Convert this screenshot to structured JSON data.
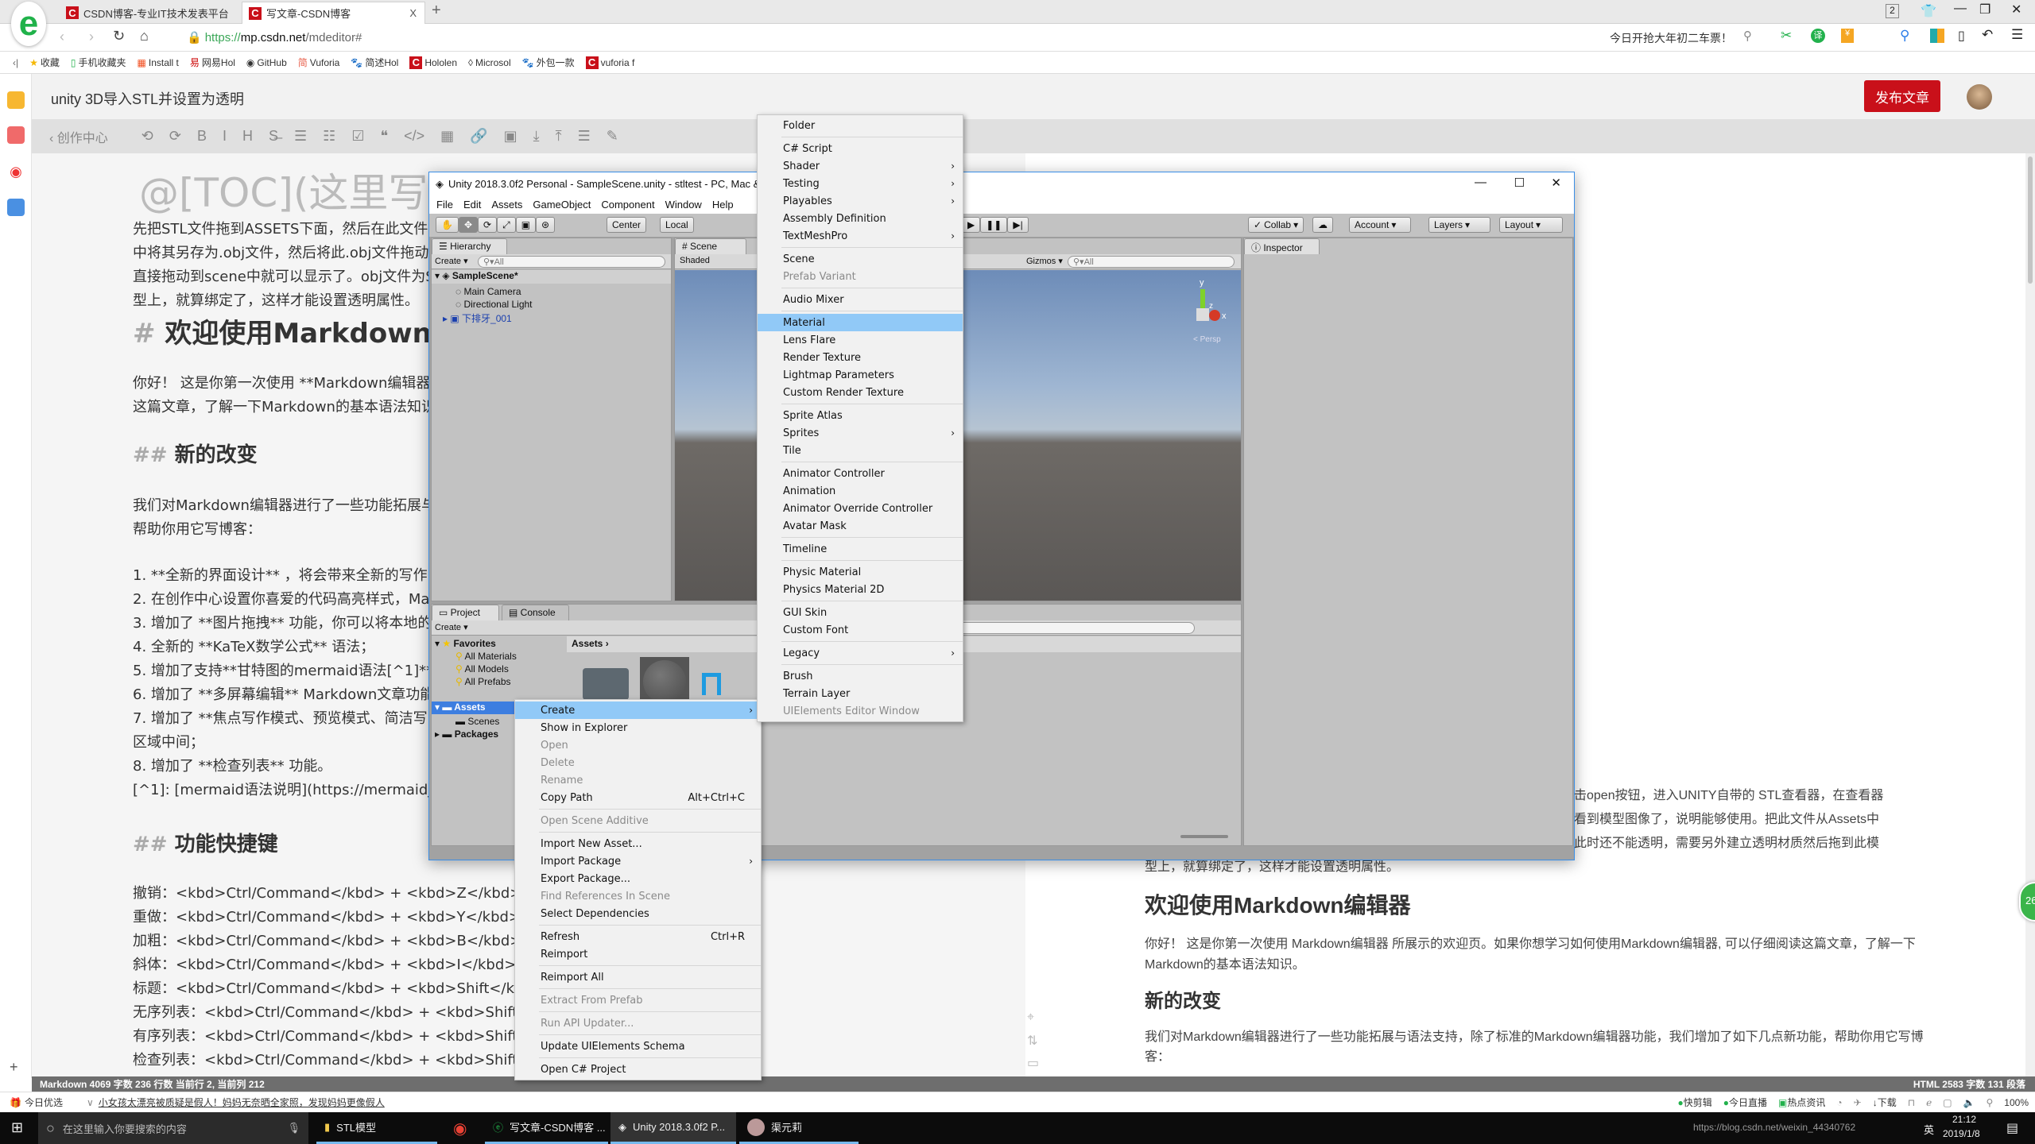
{
  "browser": {
    "tabs": [
      {
        "label": "CSDN博客-专业IT技术发表平台"
      },
      {
        "label": "写文章-CSDN博客",
        "close": "X"
      }
    ],
    "new_tab": "+",
    "url_scheme": "https://",
    "url_host": "mp.csdn.net",
    "url_path": "/mdeditor#",
    "promo": "今日开抢大年初二车票！",
    "window_count": "2",
    "bookmarks": [
      "收藏",
      "手机收藏夹",
      "Install t",
      "网易Hol",
      "GitHub",
      "Vuforia",
      "简述Hol",
      "Hololen",
      "Microsol",
      "外包一款",
      "vuforia f"
    ]
  },
  "editor": {
    "title": "unity 3D导入STL并设置为透明",
    "publish": "发布文章",
    "back": "创作中心",
    "toolbar_icons": [
      "undo-icon",
      "redo-icon",
      "bold-icon",
      "italic-icon",
      "heading-icon",
      "strikethrough-icon",
      "unordered-list-icon",
      "ordered-list-icon",
      "checklist-icon",
      "quote-icon",
      "code-icon",
      "table-icon",
      "link-icon",
      "image-icon",
      "download-icon",
      "upload-icon",
      "toc-icon",
      "sign-icon"
    ],
    "toolbar_glyphs": [
      "⟲",
      "⟳",
      "B",
      "I",
      "H",
      "S̶",
      "☰",
      "☷",
      "☑",
      "❝",
      "</>",
      "▦",
      "🔗",
      "▣",
      "⤓",
      "⤒",
      "☰",
      "✎"
    ],
    "left_lines": [
      {
        "text": "@[TOC](这里写自",
        "kind": "toc"
      },
      {
        "text": "先把STL文件拖到ASSETS下面，然后在此文件"
      },
      {
        "text": "中将其另存为.obj文件，然后将此.obj文件拖动到"
      },
      {
        "text": "直接拖动到scene中就可以显示了。obj文件为S"
      },
      {
        "text": "型上，就算绑定了，这样才能设置透明属性。"
      },
      {
        "hash": "#",
        "text": "欢迎使用Markdown编",
        "kind": "h1"
      },
      {
        "text": "你好！ 这是你第一次使用 **Markdown编辑器"
      },
      {
        "text": "这篇文章，了解一下Markdown的基本语法知识"
      },
      {
        "hash": "##",
        "text": "新的改变",
        "kind": "h2"
      },
      {
        "text": "我们对Markdown编辑器进行了一些功能拓展与"
      },
      {
        "text": "帮助你用它写博客："
      },
      {
        "text": "1. **全新的界面设计** ，将会带来全新的写作"
      },
      {
        "text": "2. 在创作中心设置你喜爱的代码高亮样式，Ma"
      },
      {
        "text": "3. 增加了 **图片拖拽** 功能，你可以将本地的"
      },
      {
        "text": "4. 全新的 **KaTeX数学公式** 语法；"
      },
      {
        "text": "5. 增加了支持**甘特图的mermaid语法[^1]** 功能"
      },
      {
        "text": "6. 增加了 **多屏幕编辑** Markdown文章功能"
      },
      {
        "text": "7. 增加了 **焦点写作模式、预览模式、简洁写"
      },
      {
        "text": "区域中间；"
      },
      {
        "text": "8. 增加了 **检查列表** 功能。"
      },
      {
        "text": "[^1]: [mermaid语法说明](https://mermaidjs.githu"
      },
      {
        "hash": "##",
        "text": "功能快捷键",
        "kind": "h2"
      },
      {
        "text": "撤销：<kbd>Ctrl/Command</kbd> + <kbd>Z</kbd>"
      },
      {
        "text": "重做：<kbd>Ctrl/Command</kbd> + <kbd>Y</kbd>"
      },
      {
        "text": "加粗：<kbd>Ctrl/Command</kbd> + <kbd>B</kbd>"
      },
      {
        "text": "斜体：<kbd>Ctrl/Command</kbd> + <kbd>I</kbd>"
      },
      {
        "text": "标题：<kbd>Ctrl/Command</kbd> + <kbd>Shift</kbd> + <kbd>H"
      },
      {
        "text": "无序列表：<kbd>Ctrl/Command</kbd> + <kbd>Shift</kbd> + <k"
      },
      {
        "text": "有序列表：<kbd>Ctrl/Command</kbd> + <kbd>Shift</kbd> + <k"
      },
      {
        "text": "检查列表：<kbd>Ctrl/Command</kbd> + <kbd>Shift</kbd> + <k"
      }
    ],
    "preview_lines": [
      {
        "text": "击open按钮，进入UNITY自带的 STL查看器，在查看器"
      },
      {
        "text": "看到模型图像了，说明能够使用。把此文件从Assets中"
      },
      {
        "text": "此时还不能透明，需要另外建立透明材质然后拖到此模"
      },
      {
        "text": "型上，就算绑定了，这样才能设置透明属性。"
      },
      {
        "text": "欢迎使用Markdown编辑器",
        "kind": "h1"
      },
      {
        "text": "你好！ 这是你第一次使用 Markdown编辑器 所展示的欢迎页。如果你想学习如何使用Markdown编辑器, 可以仔细阅读这篇文章，了解一下"
      },
      {
        "text": "Markdown的基本语法知识。"
      },
      {
        "text": "新的改变",
        "kind": "h2"
      },
      {
        "text": "我们对Markdown编辑器进行了一些功能拓展与语法支持，除了标准的Markdown编辑器功能，我们增加了如下几点新功能，帮助你用它写博"
      },
      {
        "text": "客："
      }
    ],
    "float_badge": "26",
    "status_left": "Markdown  4069 字数  236 行数  当前行 2, 当前列 212",
    "status_right": "HTML  2583 字数  131 段落"
  },
  "browser_status": {
    "left_label": "今日优选",
    "news": "小女孩太漂亮被质疑是假人！妈妈无奈晒全家照，发现妈妈更像假人",
    "right_items": [
      "快剪辑",
      "今日直播",
      "热点资讯",
      "下载"
    ],
    "zoom": "100%"
  },
  "unity": {
    "title": "Unity 2018.3.0f2 Personal - SampleScene.unity - stltest - PC, Mac &",
    "menu": [
      "File",
      "Edit",
      "Assets",
      "GameObject",
      "Component",
      "Window",
      "Help"
    ],
    "center": "Center",
    "local": "Local",
    "collab": "Collab",
    "account": "Account",
    "layers": "Layers",
    "layout": "Layout",
    "hierarchy": {
      "tab": "Hierarchy",
      "create": "Create",
      "search": "All",
      "scene": "SampleScene*",
      "items": [
        "Main Camera",
        "Directional Light",
        "下排牙_001"
      ]
    },
    "scene": {
      "tab": "Scene",
      "shaded": "Shaded",
      "gizmos": "Gizmos",
      "search": "All",
      "axis_y": "y",
      "axis_x": "x",
      "axis_z": "z",
      "persp": "< Persp"
    },
    "inspector": {
      "tab": "Inspector"
    },
    "project": {
      "tab": "Project",
      "console": "Console",
      "create": "Create",
      "favorites": "Favorites",
      "fav_items": [
        "All Materials",
        "All Models",
        "All Prefabs"
      ],
      "assets": "Assets",
      "sub": [
        "Scenes"
      ],
      "packages": "Packages",
      "breadcrumb": "Assets"
    },
    "context_menu": [
      {
        "label": "Create",
        "arrow": true,
        "highlight": true
      },
      {
        "label": "Show in Explorer"
      },
      {
        "label": "Open",
        "disabled": true
      },
      {
        "label": "Delete",
        "disabled": true
      },
      {
        "label": "Rename",
        "disabled": true
      },
      {
        "label": "Copy Path",
        "shortcut": "Alt+Ctrl+C"
      },
      {
        "sep": true
      },
      {
        "label": "Open Scene Additive",
        "disabled": true
      },
      {
        "sep": true
      },
      {
        "label": "Import New Asset..."
      },
      {
        "label": "Import Package",
        "arrow": true
      },
      {
        "label": "Export Package..."
      },
      {
        "label": "Find References In Scene",
        "disabled": true
      },
      {
        "label": "Select Dependencies"
      },
      {
        "sep": true
      },
      {
        "label": "Refresh",
        "shortcut": "Ctrl+R"
      },
      {
        "label": "Reimport"
      },
      {
        "sep": true
      },
      {
        "label": "Reimport All"
      },
      {
        "sep": true
      },
      {
        "label": "Extract From Prefab",
        "disabled": true
      },
      {
        "sep": true
      },
      {
        "label": "Run API Updater...",
        "disabled": true
      },
      {
        "sep": true
      },
      {
        "label": "Update UIElements Schema"
      },
      {
        "sep": true
      },
      {
        "label": "Open C# Project"
      }
    ],
    "create_submenu": [
      {
        "label": "Folder"
      },
      {
        "sep": true
      },
      {
        "label": "C# Script"
      },
      {
        "label": "Shader",
        "arrow": true
      },
      {
        "label": "Testing",
        "arrow": true
      },
      {
        "label": "Playables",
        "arrow": true
      },
      {
        "label": "Assembly Definition"
      },
      {
        "label": "TextMeshPro",
        "arrow": true
      },
      {
        "sep": true
      },
      {
        "label": "Scene"
      },
      {
        "label": "Prefab Variant",
        "disabled": true
      },
      {
        "sep": true
      },
      {
        "label": "Audio Mixer"
      },
      {
        "sep": true
      },
      {
        "label": "Material",
        "highlight": true
      },
      {
        "label": "Lens Flare"
      },
      {
        "label": "Render Texture"
      },
      {
        "label": "Lightmap Parameters"
      },
      {
        "label": "Custom Render Texture"
      },
      {
        "sep": true
      },
      {
        "label": "Sprite Atlas"
      },
      {
        "label": "Sprites",
        "arrow": true
      },
      {
        "label": "Tile"
      },
      {
        "sep": true
      },
      {
        "label": "Animator Controller"
      },
      {
        "label": "Animation"
      },
      {
        "label": "Animator Override Controller"
      },
      {
        "label": "Avatar Mask"
      },
      {
        "sep": true
      },
      {
        "label": "Timeline"
      },
      {
        "sep": true
      },
      {
        "label": "Physic Material"
      },
      {
        "label": "Physics Material 2D"
      },
      {
        "sep": true
      },
      {
        "label": "GUI Skin"
      },
      {
        "label": "Custom Font"
      },
      {
        "sep": true
      },
      {
        "label": "Legacy",
        "arrow": true
      },
      {
        "sep": true
      },
      {
        "label": "Brush"
      },
      {
        "label": "Terrain Layer"
      },
      {
        "label": "UIElements Editor Window",
        "disabled": true
      }
    ]
  },
  "taskbar": {
    "search": "在这里输入你要搜索的内容",
    "apps": [
      "STL模型",
      "写文章-CSDN博客 ...",
      "Unity 2018.3.0f2 P...",
      "渠元莉"
    ],
    "time": "21:12",
    "date": "2019/1/8",
    "ime": "英",
    "watermark": "https://blog.csdn.net/weixin_44340762"
  },
  "colors": {
    "brand_red": "#c9101a",
    "highlight": "#91c9f7",
    "selection_blue": "#3d7ee0"
  }
}
